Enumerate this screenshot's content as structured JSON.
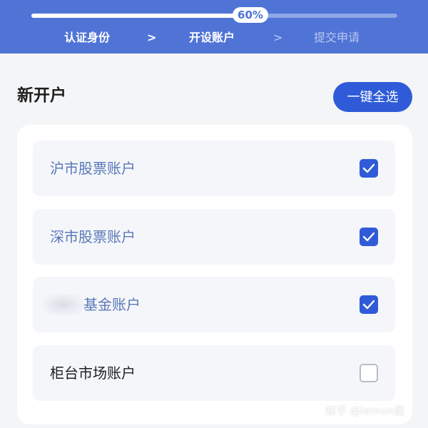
{
  "progress": {
    "percent_label": "60%",
    "fraction": 0.6
  },
  "steps": {
    "step1": "认证身份",
    "arrow1": ">",
    "step2": "开设账户",
    "arrow2": ">",
    "step3": "提交申请"
  },
  "section": {
    "title": "新开户",
    "select_all_label": "一键全选"
  },
  "accounts": [
    {
      "label": "沪市股票账户",
      "checked": true
    },
    {
      "label": "深市股票账户",
      "checked": true
    },
    {
      "label": "基金账户",
      "checked": true,
      "prefix_obscured": true
    },
    {
      "label": "柜台市场账户",
      "checked": false
    }
  ],
  "watermark": "知乎 @lemon墨",
  "colors": {
    "header_blue": "#4f74d6",
    "accent_blue": "#2f5bd8"
  }
}
